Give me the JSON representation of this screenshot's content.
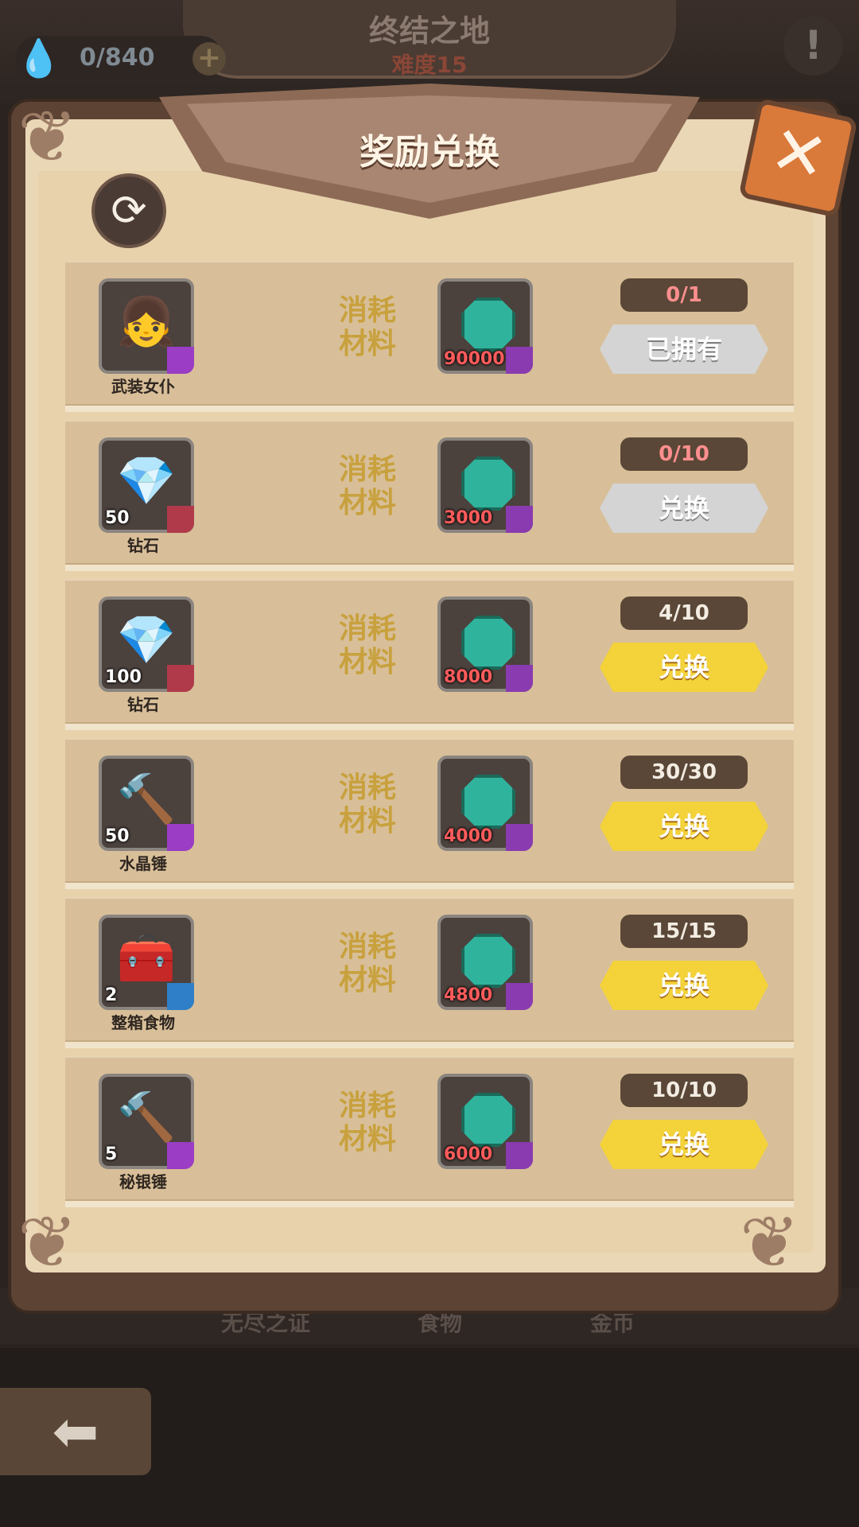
{
  "stage": {
    "title": "终结之地",
    "difficulty": "难度15"
  },
  "energy": {
    "value": "0/840",
    "plus": "+",
    "drop": "💧"
  },
  "alert": {
    "symbol": "!"
  },
  "modal": {
    "title": "奖励兑换",
    "close": "✕",
    "refresh": "⟳"
  },
  "consume_label_line1": "消耗",
  "consume_label_line2": "材料",
  "rows": [
    {
      "art": "👧",
      "rarity_color": "#9b3dc5",
      "count": "",
      "name": "武装女仆",
      "cost": "90000",
      "limit": "0/1",
      "limit_red": true,
      "button": "已拥有",
      "button_state": "gray"
    },
    {
      "art": "💎",
      "rarity_color": "#b03a4a",
      "count": "50",
      "name": "钻石",
      "cost": "3000",
      "limit": "0/10",
      "limit_red": true,
      "button": "兑换",
      "button_state": "gray"
    },
    {
      "art": "💎",
      "rarity_color": "#b03a4a",
      "count": "100",
      "name": "钻石",
      "cost": "8000",
      "limit": "4/10",
      "limit_red": false,
      "button": "兑换",
      "button_state": "gold"
    },
    {
      "art": "🔨",
      "rarity_color": "#9b3dc5",
      "count": "50",
      "name": "水晶锤",
      "cost": "4000",
      "limit": "30/30",
      "limit_red": false,
      "button": "兑换",
      "button_state": "gold"
    },
    {
      "art": "🧰",
      "rarity_color": "#2e7fc7",
      "count": "2",
      "name": "整箱食物",
      "cost": "4800",
      "limit": "15/15",
      "limit_red": false,
      "button": "兑换",
      "button_state": "gold"
    },
    {
      "art": "🔨",
      "rarity_color": "#9b3dc5",
      "count": "5",
      "name": "秘银锤",
      "cost": "6000",
      "limit": "10/10",
      "limit_red": false,
      "button": "兑换",
      "button_state": "gold"
    }
  ],
  "bottom_tabs": [
    "无尽之证",
    "食物",
    "金币"
  ],
  "back": {
    "symbol": "⬅"
  }
}
